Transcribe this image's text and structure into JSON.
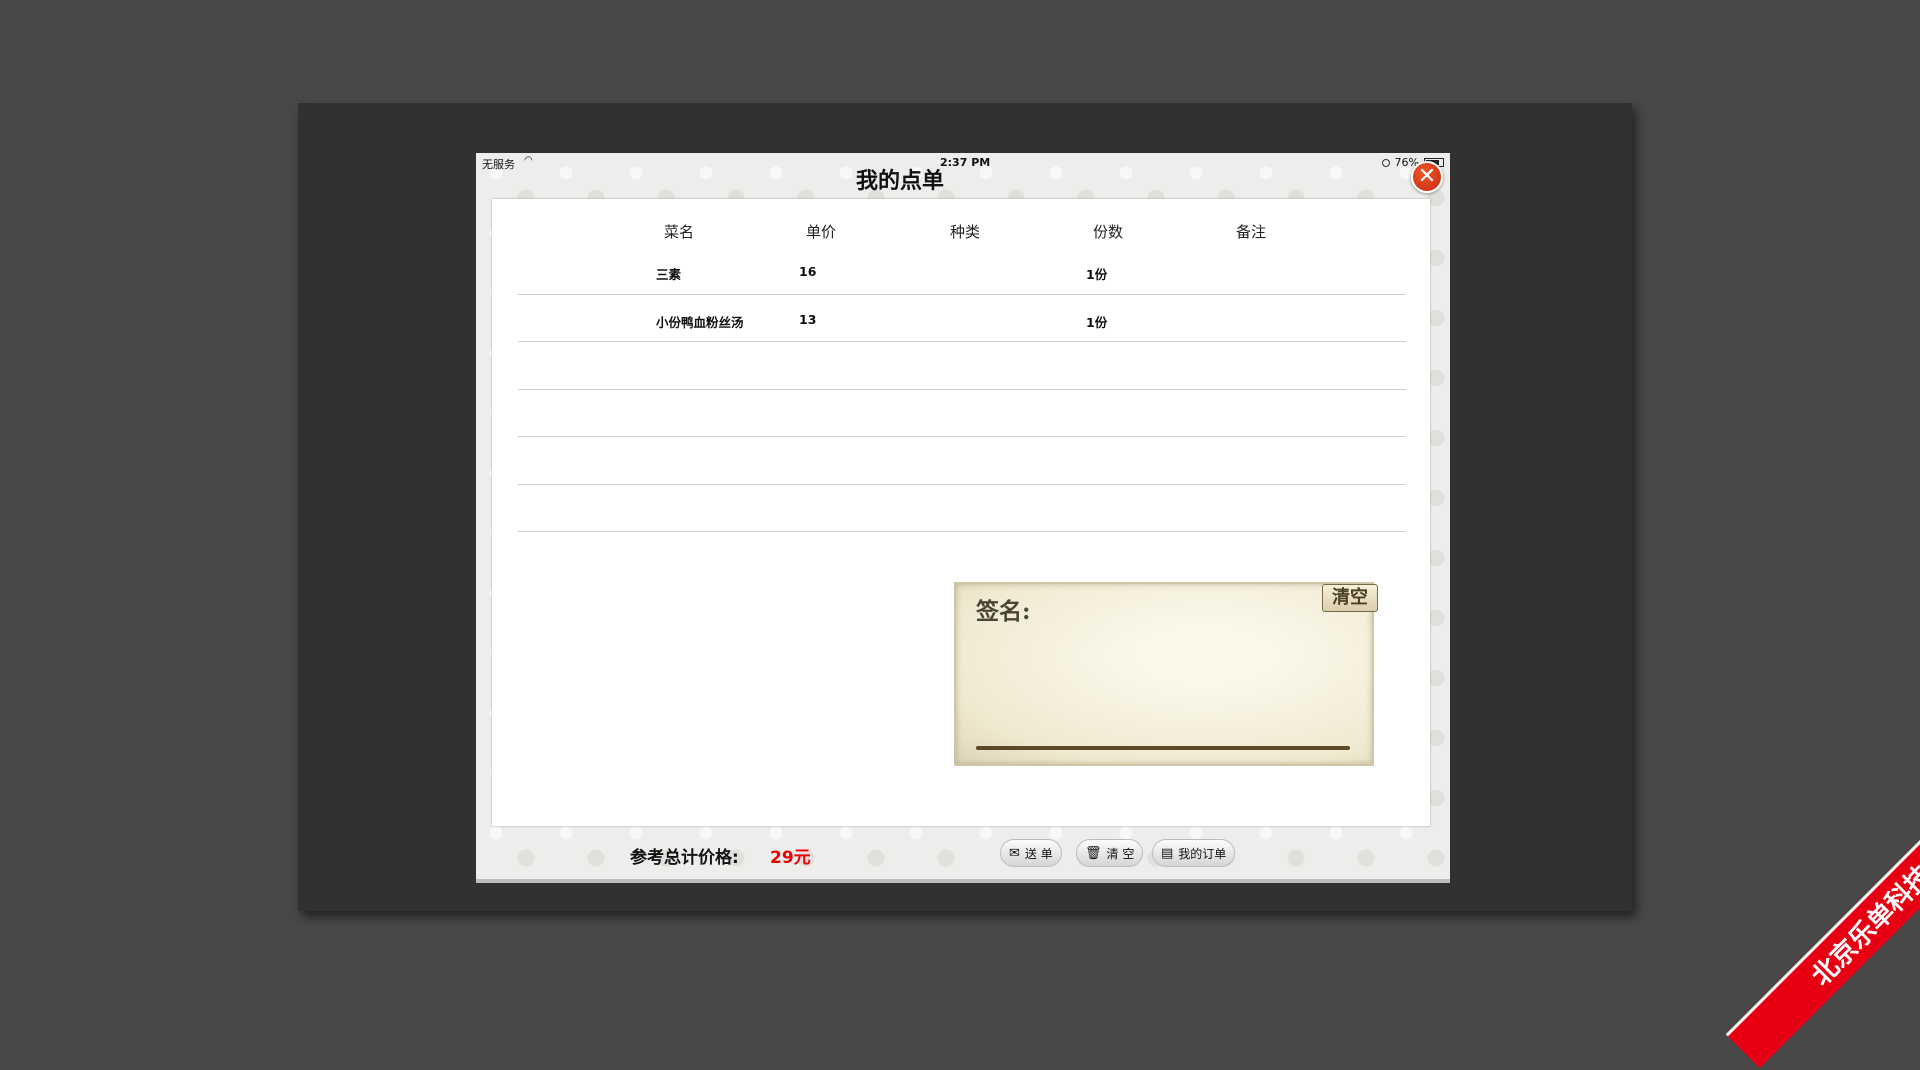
{
  "status_bar": {
    "carrier": "无服务",
    "time": "2:37 PM",
    "battery": "76%"
  },
  "dialog": {
    "title": "我的点单",
    "close_glyph": "✕"
  },
  "table": {
    "headers": [
      "菜名",
      "单价",
      "种类",
      "份数",
      "备注"
    ],
    "rows": [
      {
        "name": "三素",
        "price": "16",
        "type": "",
        "qty": "1份",
        "note": ""
      },
      {
        "name": "小份鸭血粉丝汤",
        "price": "13",
        "type": "",
        "qty": "1份",
        "note": ""
      },
      {
        "name": "",
        "price": "",
        "type": "",
        "qty": "",
        "note": ""
      },
      {
        "name": "",
        "price": "",
        "type": "",
        "qty": "",
        "note": ""
      },
      {
        "name": "",
        "price": "",
        "type": "",
        "qty": "",
        "note": ""
      },
      {
        "name": "",
        "price": "",
        "type": "",
        "qty": "",
        "note": ""
      }
    ]
  },
  "signature": {
    "label": "签名:",
    "clear_label": "清空"
  },
  "footer": {
    "total_label": "参考总计价格:",
    "total_value": "29元",
    "send_label": "送 单",
    "clear_label": "清 空",
    "my_orders_label": "我的订单"
  },
  "watermark": {
    "text": "北京乐单科技"
  },
  "colors": {
    "close_button": "#d8380f",
    "total_value": "#ee0000",
    "ribbon": "#e60012"
  },
  "icons": {
    "send": "envelope-icon",
    "clear": "trash-icon",
    "orders": "document-icon"
  }
}
